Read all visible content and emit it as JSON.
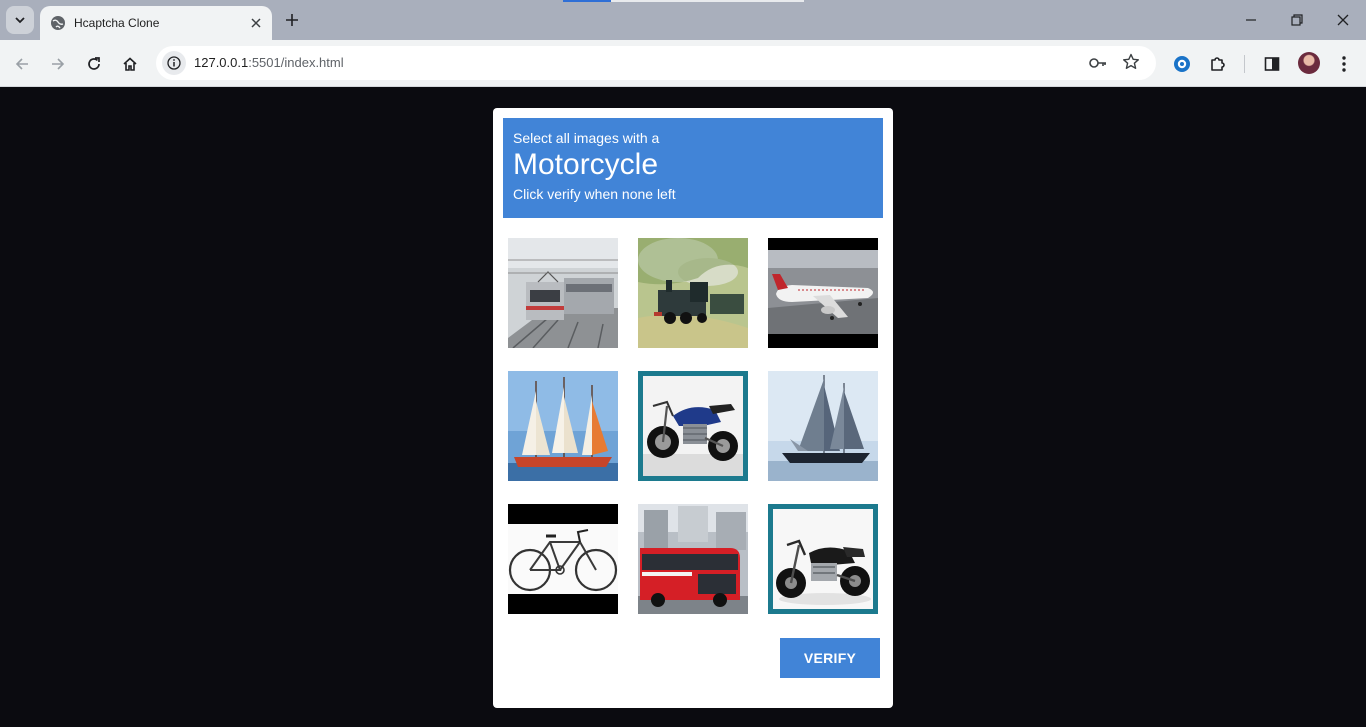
{
  "browser": {
    "tab_title": "Hcaptcha Clone",
    "url_host": "127.0.0.1",
    "url_path": ":5501/index.html"
  },
  "captcha": {
    "instruction": "Select all images with a",
    "target": "Motorcycle",
    "subtext": "Click verify when none left",
    "verify_label": "VERIFY",
    "header_color": "#4184d7",
    "selected_border_color": "#1c7a8e",
    "tiles": [
      {
        "subject": "electric-train",
        "selected": false
      },
      {
        "subject": "steam-train",
        "selected": false
      },
      {
        "subject": "airplane",
        "selected": false
      },
      {
        "subject": "sailing-ship",
        "selected": false
      },
      {
        "subject": "motorcycle",
        "selected": true
      },
      {
        "subject": "sailing-ship",
        "selected": false
      },
      {
        "subject": "bicycle",
        "selected": false
      },
      {
        "subject": "red-bus",
        "selected": false
      },
      {
        "subject": "motorcycle",
        "selected": true
      }
    ]
  }
}
